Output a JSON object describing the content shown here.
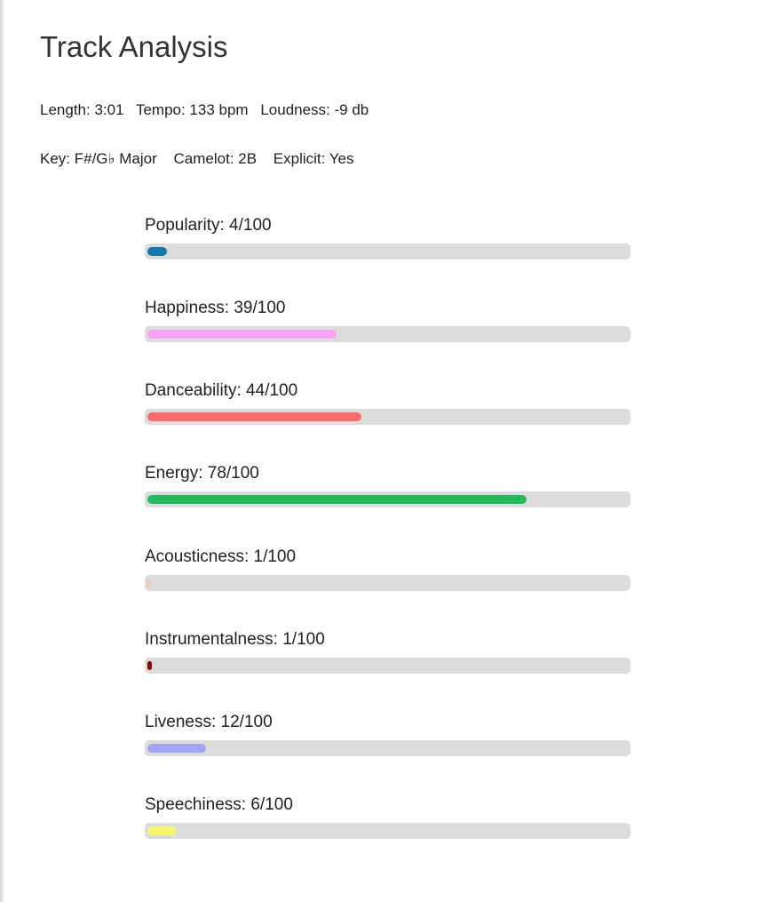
{
  "page": {
    "title": "Track Analysis"
  },
  "info": {
    "length": "Length: 3:01",
    "tempo": "Tempo: 133 bpm",
    "loudness": "Loudness: -9 db",
    "key": "Key: F#/G♭ Major",
    "camelot": "Camelot: 2B",
    "explicit": "Explicit: Yes"
  },
  "colors": {
    "track_background": "#dcdcdc"
  },
  "metrics": [
    {
      "id": "popularity",
      "label": "Popularity: 4/100",
      "value": 4,
      "max": 100,
      "color": "#1578a8"
    },
    {
      "id": "happiness",
      "label": "Happiness: 39/100",
      "value": 39,
      "max": 100,
      "color": "#f6a3f2"
    },
    {
      "id": "danceability",
      "label": "Danceability: 44/100",
      "value": 44,
      "max": 100,
      "color": "#fb6b6d"
    },
    {
      "id": "energy",
      "label": "Energy: 78/100",
      "value": 78,
      "max": 100,
      "color": "#22bb5c"
    },
    {
      "id": "acousticness",
      "label": "Acousticness: 1/100",
      "value": 1,
      "max": 100,
      "color": "#e9cfb4"
    },
    {
      "id": "instrumentalness",
      "label": "Instrumentalness: 1/100",
      "value": 1,
      "max": 100,
      "color": "#8b0000"
    },
    {
      "id": "liveness",
      "label": "Liveness: 12/100",
      "value": 12,
      "max": 100,
      "color": "#a4a4f6"
    },
    {
      "id": "speechiness",
      "label": "Speechiness: 6/100",
      "value": 6,
      "max": 100,
      "color": "#f5f86a"
    }
  ]
}
